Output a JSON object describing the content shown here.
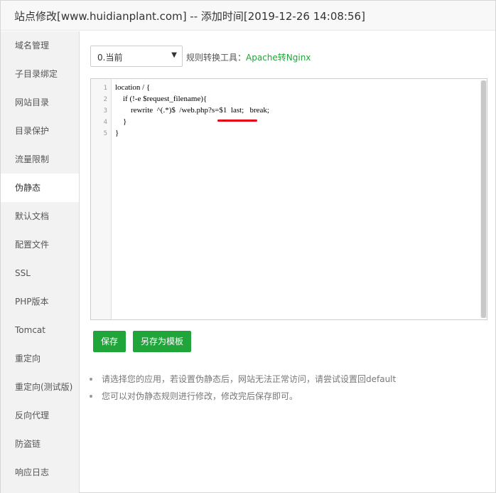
{
  "window": {
    "title": "站点修改[www.huidianplant.com] -- 添加时间[2019-12-26 14:08:56]"
  },
  "sidebar": {
    "items": [
      {
        "label": "域名管理"
      },
      {
        "label": "子目录绑定"
      },
      {
        "label": "网站目录"
      },
      {
        "label": "目录保护"
      },
      {
        "label": "流量限制"
      },
      {
        "label": "伪静态",
        "active": true
      },
      {
        "label": "默认文档"
      },
      {
        "label": "配置文件"
      },
      {
        "label": "SSL"
      },
      {
        "label": "PHP版本"
      },
      {
        "label": "Tomcat"
      },
      {
        "label": "重定向"
      },
      {
        "label": "重定向(测试版)"
      },
      {
        "label": "反向代理"
      },
      {
        "label": "防盗链"
      },
      {
        "label": "响应日志"
      }
    ]
  },
  "rewrite": {
    "select_value": "0.当前",
    "tool_label": "规则转换工具：",
    "tool_link": "Apache转Nginx",
    "code_lines": [
      {
        "num": "1",
        "text": "location / {"
      },
      {
        "num": "2",
        "text": "    if (!-e $request_filename){"
      },
      {
        "num": "3",
        "text": "        rewrite  ^(.*)$  /web.php?s=$1  last;   break;"
      },
      {
        "num": "4",
        "text": "    }"
      },
      {
        "num": "5",
        "text": "}"
      }
    ],
    "save_label": "保存",
    "save_template_label": "另存为模板",
    "tips": [
      "请选择您的应用，若设置伪静态后，网站无法正常访问，请尝试设置回default",
      "您可以对伪静态规则进行修改，修改完后保存即可。"
    ]
  },
  "colors": {
    "accent": "#20a53a",
    "annotation": "#e60012"
  }
}
